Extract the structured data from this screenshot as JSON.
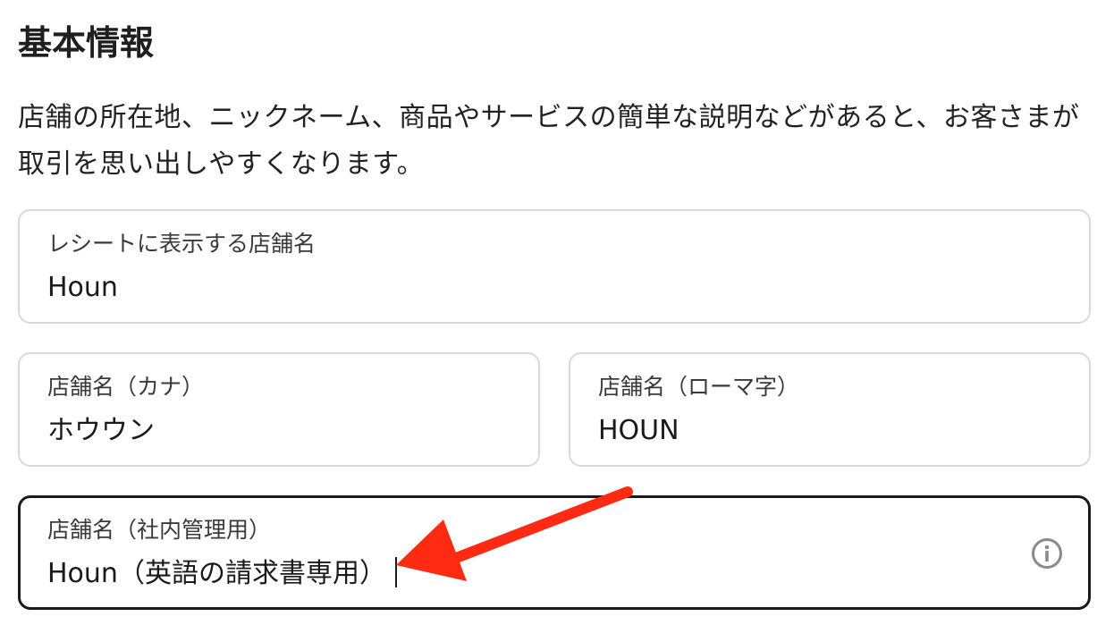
{
  "section": {
    "title": "基本情報",
    "description": "店舗の所在地、ニックネーム、商品やサービスの簡単な説明などがあると、お客さまが取引を思い出しやすくなります。"
  },
  "fields": {
    "receipt_name": {
      "label": "レシートに表示する店舗名",
      "value": "Houn"
    },
    "kana_name": {
      "label": "店舗名（カナ）",
      "value": "ホウウン"
    },
    "romaji_name": {
      "label": "店舗名（ローマ字）",
      "value": "HOUN"
    },
    "internal_name": {
      "label": "店舗名（社内管理用）",
      "value": "Houn（英語の請求書専用）"
    }
  },
  "icons": {
    "info": "info-icon",
    "annotation": "red-arrow"
  },
  "colors": {
    "focused_border": "#1a1a1a",
    "border": "#d9d9d9",
    "arrow": "#ff2a12",
    "info_icon": "#8a8a8a"
  }
}
